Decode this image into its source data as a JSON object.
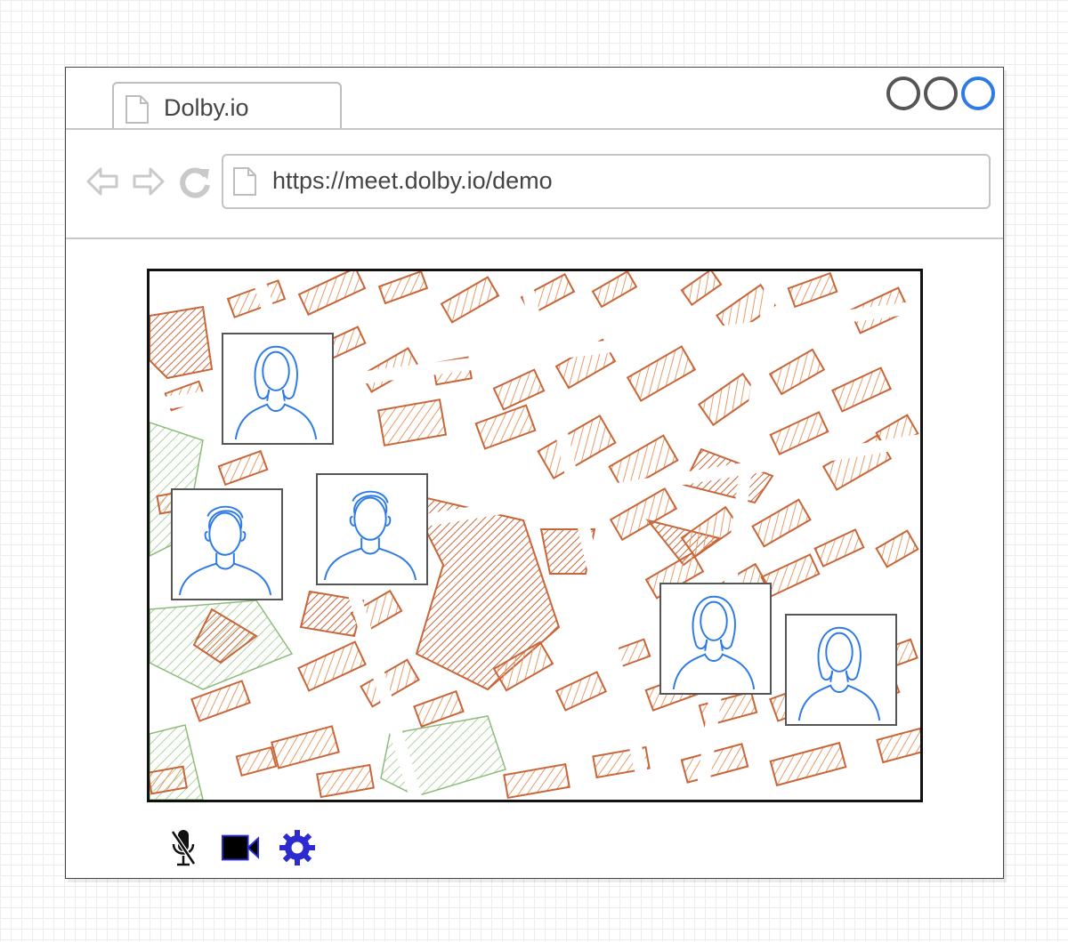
{
  "tab": {
    "label": "Dolby.io",
    "icon": "page-icon"
  },
  "window_controls": [
    "circle-icon",
    "circle-icon",
    "circle-icon"
  ],
  "navigation": {
    "back_icon": "back-arrow-icon",
    "forward_icon": "forward-arrow-icon",
    "reload_icon": "reload-icon"
  },
  "address_bar": {
    "url": "https://meet.dolby.io/demo",
    "icon": "page-icon"
  },
  "map": {
    "background": "street-map"
  },
  "participants": [
    {
      "avatar": "female-avatar-icon"
    },
    {
      "avatar": "male-avatar-icon"
    },
    {
      "avatar": "male-avatar-icon"
    },
    {
      "avatar": "female-avatar-icon"
    },
    {
      "avatar": "female-avatar-icon"
    }
  ],
  "toolbar": {
    "mic_icon": "mic-muted-icon",
    "camera_icon": "video-camera-icon",
    "settings_icon": "gear-icon"
  },
  "colors": {
    "accent": "#2e7be6",
    "buildings": "#c8663a",
    "parks": "#8dbb7a",
    "toolbar_blue": "#2b2bd0"
  }
}
